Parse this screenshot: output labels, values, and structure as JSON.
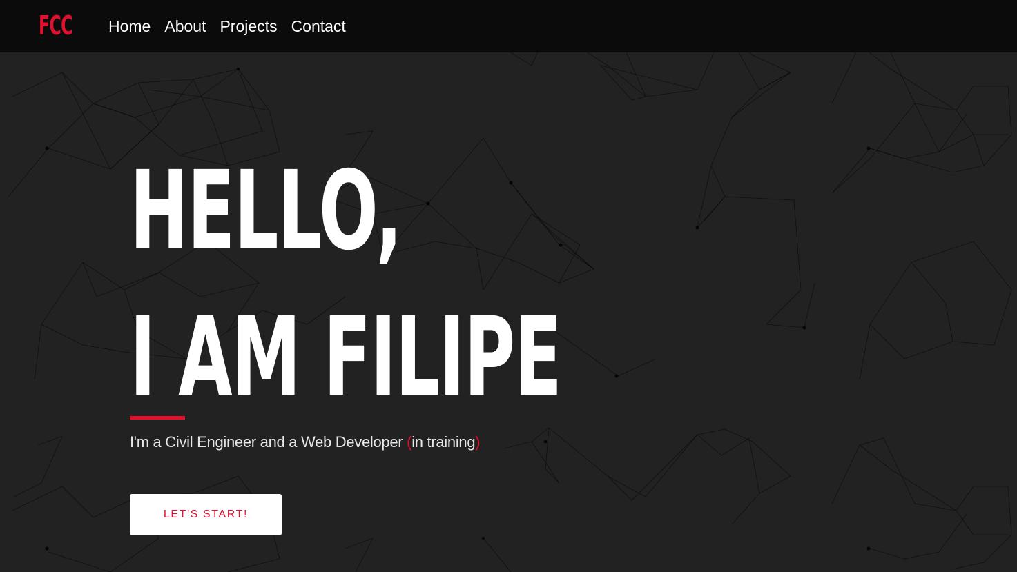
{
  "colors": {
    "accent": "#e0102e",
    "background": "#222222",
    "navbar": "#0b0b0b",
    "text": "#ffffff"
  },
  "navbar": {
    "logo": "FCC",
    "links": [
      "Home",
      "About",
      "Projects",
      "Contact"
    ]
  },
  "hero": {
    "headline_line1": "HELLO,",
    "headline_line2": "I AM FILIPE",
    "subtitle_main": "I'm a Civil Engineer and a Web Developer ",
    "subtitle_paren_open": "(",
    "subtitle_inner": "in training",
    "subtitle_paren_close": ")",
    "cta_label": "LET'S START!"
  }
}
